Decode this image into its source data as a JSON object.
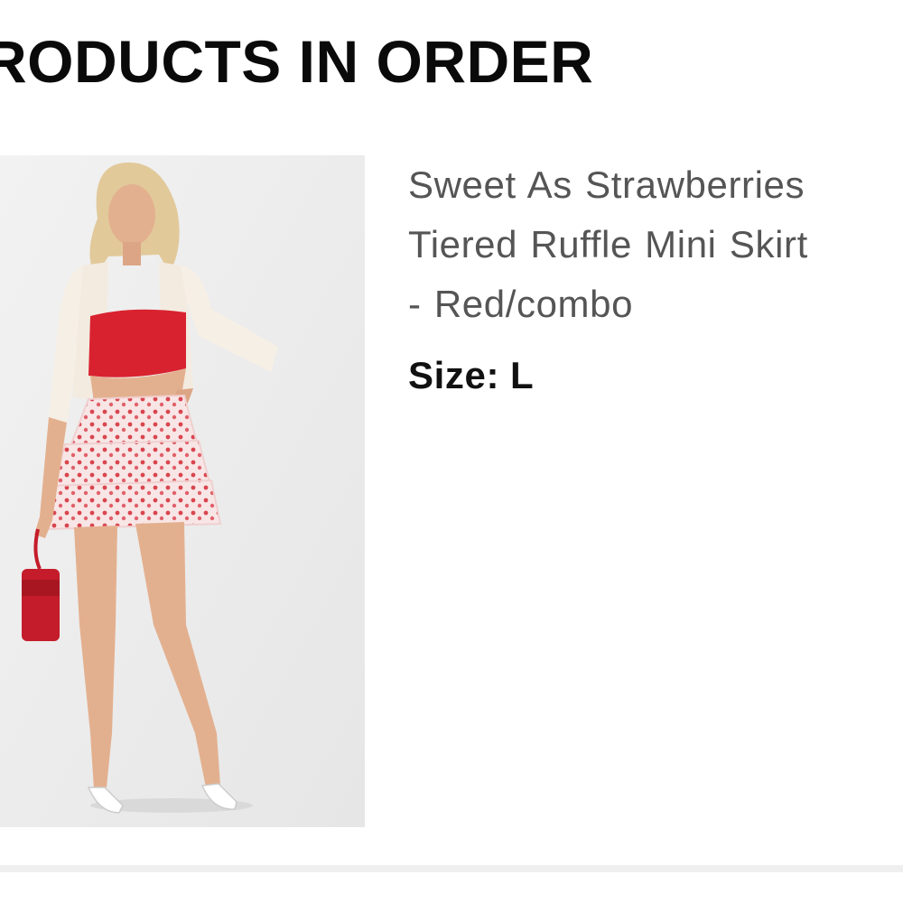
{
  "section": {
    "title": "RODUCTS IN ORDER"
  },
  "product": {
    "name_lines": [
      "Sweet As Strawberries",
      "Tiered Ruffle Mini Skirt",
      "- Red/combo"
    ],
    "size_label": "Size:",
    "size_value": "L",
    "image_icon": "product-photo"
  },
  "colors": {
    "title": "#0a0a0a",
    "product_name": "#555555",
    "accent_red": "#d9222f",
    "image_bg": "#eeeeee",
    "divider": "#efefef"
  }
}
